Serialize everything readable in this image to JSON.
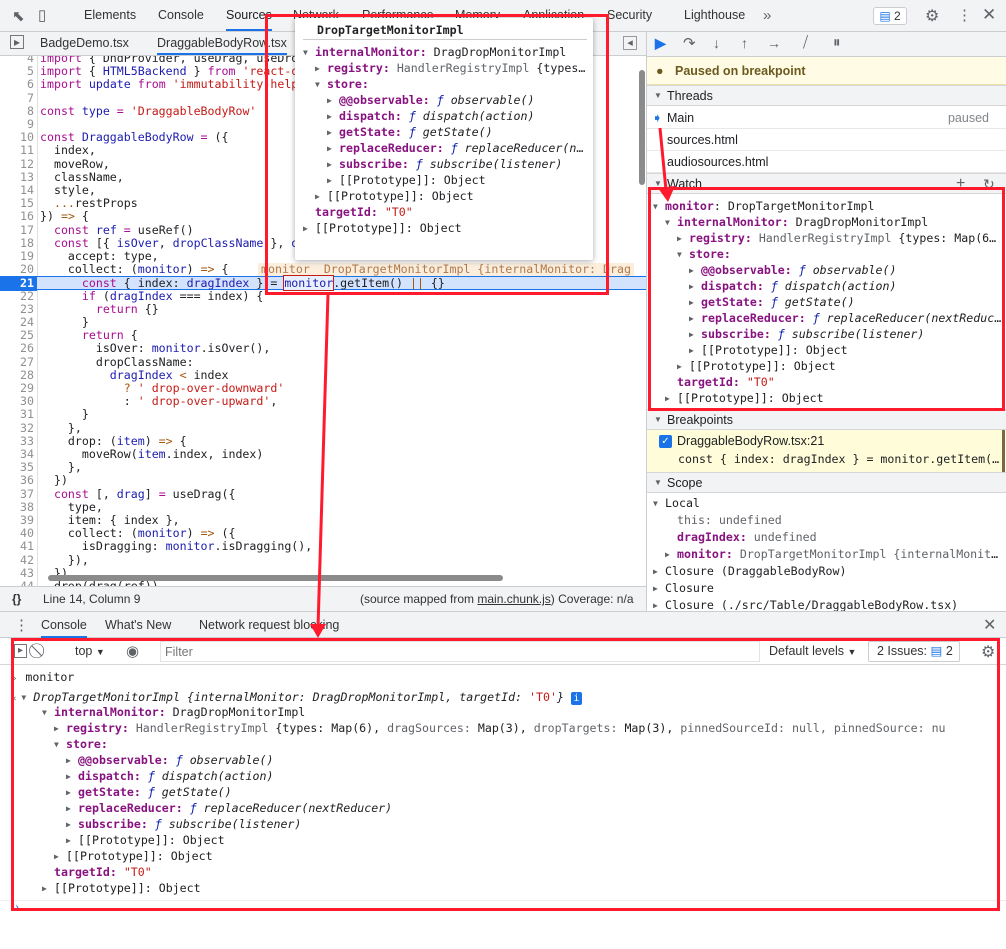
{
  "topbar": {
    "tabs": [
      "Elements",
      "Console",
      "Sources",
      "Network",
      "Performance",
      "Memory",
      "Application",
      "Security",
      "Lighthouse"
    ],
    "active_tab": "Sources",
    "more": "»",
    "issues_count": "2"
  },
  "file_tabs": {
    "items": [
      "BadgeDemo.tsx",
      "DraggableBodyRow.tsx"
    ],
    "active": "DraggableBodyRow.tsx"
  },
  "editor": {
    "current_line": 21,
    "inline_hint": "monitor  DropTargetMonitorImpl {internalMonitor: Drag",
    "lines": [
      {
        "n": "4",
        "t": [
          [
            "k",
            "import"
          ],
          [
            "p",
            " { DndProvider, useDrag, useDrop } from 'react-dnd'"
          ]
        ]
      },
      {
        "n": "5",
        "t": [
          [
            "k",
            "import"
          ],
          [
            "p",
            " { "
          ],
          [
            "d",
            "HTML5Backend"
          ],
          [
            "p",
            " } "
          ],
          [
            "k",
            "from"
          ],
          [
            "s",
            " 'react-dnd-html5-backend'"
          ]
        ]
      },
      {
        "n": "6",
        "t": [
          [
            "k",
            "import"
          ],
          [
            "p",
            " "
          ],
          [
            "d",
            "update"
          ],
          [
            "p",
            " "
          ],
          [
            "k",
            "from"
          ],
          [
            "s",
            " 'immutability-helper'"
          ]
        ]
      },
      {
        "n": "7",
        "t": []
      },
      {
        "n": "8",
        "t": [
          [
            "k",
            "const"
          ],
          [
            "p",
            " "
          ],
          [
            "d",
            "type"
          ],
          [
            "k",
            " ="
          ],
          [
            "s",
            " 'DraggableBodyRow'"
          ]
        ]
      },
      {
        "n": "9",
        "t": []
      },
      {
        "n": "10",
        "t": [
          [
            "k",
            "const"
          ],
          [
            "p",
            " "
          ],
          [
            "d",
            "DraggableBodyRow"
          ],
          [
            "k",
            " ="
          ],
          [
            "p",
            " ({"
          ]
        ]
      },
      {
        "n": "11",
        "t": [
          [
            "p",
            "  index,"
          ]
        ]
      },
      {
        "n": "12",
        "t": [
          [
            "p",
            "  moveRow,"
          ]
        ]
      },
      {
        "n": "13",
        "t": [
          [
            "p",
            "  className,"
          ]
        ]
      },
      {
        "n": "14",
        "t": [
          [
            "p",
            "  style,"
          ]
        ]
      },
      {
        "n": "15",
        "t": [
          [
            "a",
            "  ..."
          ],
          [
            "p",
            "restProps"
          ]
        ]
      },
      {
        "n": "16",
        "t": [
          [
            "p",
            "}) "
          ],
          [
            "a",
            "=>"
          ],
          [
            "p",
            " {"
          ]
        ]
      },
      {
        "n": "17",
        "t": [
          [
            "k",
            "  const"
          ],
          [
            "p",
            " "
          ],
          [
            "d",
            "ref"
          ],
          [
            "k",
            " ="
          ],
          [
            "p",
            " useRef()"
          ]
        ]
      },
      {
        "n": "18",
        "t": [
          [
            "k",
            "  const"
          ],
          [
            "p",
            " [{ "
          ],
          [
            "d",
            "isOver"
          ],
          [
            "p",
            ", "
          ],
          [
            "d",
            "dropClassName"
          ],
          [
            "p",
            " }, "
          ],
          [
            "d",
            "drop"
          ],
          [
            "p",
            "] = useDrop({"
          ]
        ]
      },
      {
        "n": "19",
        "t": [
          [
            "p",
            "    accept: type,"
          ]
        ]
      },
      {
        "n": "20",
        "t": [
          [
            "p",
            "    collect: ("
          ],
          [
            "d",
            "monitor"
          ],
          [
            "p",
            ") "
          ],
          [
            "a",
            "=>"
          ],
          [
            "p",
            " {"
          ]
        ]
      },
      {
        "n": "21",
        "t": [
          [
            "k",
            "      const"
          ],
          [
            "p",
            " { index: "
          ],
          [
            "d",
            "dragIndex"
          ],
          [
            "p",
            " } = "
          ],
          [
            "m",
            "monitor"
          ],
          [
            "p",
            ".getItem() "
          ],
          [
            "a",
            "||"
          ],
          [
            "p",
            " {}"
          ]
        ]
      },
      {
        "n": "22",
        "t": [
          [
            "k",
            "      if"
          ],
          [
            "p",
            " ("
          ],
          [
            "d",
            "dragIndex"
          ],
          [
            "p",
            " === index) {"
          ]
        ]
      },
      {
        "n": "23",
        "t": [
          [
            "k",
            "        return"
          ],
          [
            "p",
            " {}"
          ]
        ]
      },
      {
        "n": "24",
        "t": [
          [
            "p",
            "      }"
          ]
        ]
      },
      {
        "n": "25",
        "t": [
          [
            "k",
            "      return"
          ],
          [
            "p",
            " {"
          ]
        ]
      },
      {
        "n": "26",
        "t": [
          [
            "p",
            "        isOver: "
          ],
          [
            "d",
            "monitor"
          ],
          [
            "p",
            ".isOver(),"
          ]
        ]
      },
      {
        "n": "27",
        "t": [
          [
            "p",
            "        dropClassName:"
          ]
        ]
      },
      {
        "n": "28",
        "t": [
          [
            "d",
            "          dragIndex"
          ],
          [
            "a",
            " <"
          ],
          [
            "p",
            " index"
          ]
        ]
      },
      {
        "n": "29",
        "t": [
          [
            "a",
            "            ?"
          ],
          [
            "s",
            " ' drop-over-downward'"
          ]
        ]
      },
      {
        "n": "30",
        "t": [
          [
            "p",
            "            : "
          ],
          [
            "s",
            "' drop-over-upward'"
          ],
          [
            "p",
            ","
          ]
        ]
      },
      {
        "n": "31",
        "t": [
          [
            "p",
            "      }"
          ]
        ]
      },
      {
        "n": "32",
        "t": [
          [
            "p",
            "    },"
          ]
        ]
      },
      {
        "n": "33",
        "t": [
          [
            "p",
            "    drop: ("
          ],
          [
            "d",
            "item"
          ],
          [
            "p",
            ") "
          ],
          [
            "a",
            "=>"
          ],
          [
            "p",
            " {"
          ]
        ]
      },
      {
        "n": "34",
        "t": [
          [
            "p",
            "      moveRow("
          ],
          [
            "d",
            "item"
          ],
          [
            "p",
            ".index, index)"
          ]
        ]
      },
      {
        "n": "35",
        "t": [
          [
            "p",
            "    },"
          ]
        ]
      },
      {
        "n": "36",
        "t": [
          [
            "p",
            "  })"
          ]
        ]
      },
      {
        "n": "37",
        "t": [
          [
            "k",
            "  const"
          ],
          [
            "p",
            " [, "
          ],
          [
            "d",
            "drag"
          ],
          [
            "p",
            "] "
          ],
          [
            "k",
            "="
          ],
          [
            "p",
            " useDrag({"
          ]
        ]
      },
      {
        "n": "38",
        "t": [
          [
            "p",
            "    type,"
          ]
        ]
      },
      {
        "n": "39",
        "t": [
          [
            "p",
            "    item: { index },"
          ]
        ]
      },
      {
        "n": "40",
        "t": [
          [
            "p",
            "    collect: ("
          ],
          [
            "d",
            "monitor"
          ],
          [
            "p",
            ") "
          ],
          [
            "a",
            "=>"
          ],
          [
            "p",
            " ({"
          ]
        ]
      },
      {
        "n": "41",
        "t": [
          [
            "p",
            "      isDragging: "
          ],
          [
            "d",
            "monitor"
          ],
          [
            "p",
            ".isDragging(),"
          ]
        ]
      },
      {
        "n": "42",
        "t": [
          [
            "p",
            "    }),"
          ]
        ]
      },
      {
        "n": "43",
        "t": [
          [
            "p",
            "  })"
          ]
        ]
      },
      {
        "n": "44",
        "t": [
          [
            "p",
            "  drop(drag(ref))"
          ]
        ]
      }
    ]
  },
  "status_bar": {
    "format_icon": "{}",
    "position": "Line 14, Column 9",
    "source_prefix": "(source mapped from ",
    "source_link": "main.chunk.js",
    "source_suffix": ")",
    "coverage": "Coverage: n/a"
  },
  "popover": {
    "title": "DropTargetMonitorImpl"
  },
  "monitor_tree": [
    {
      "d": 0,
      "tog": "down",
      "key": "internalMonitor",
      "kc": "prop",
      "v": [
        [
          "p",
          "DragDropMonitorImpl"
        ]
      ]
    },
    {
      "d": 1,
      "tog": "right",
      "key": "registry",
      "kc": "prop",
      "v": [
        [
          "g",
          "HandlerRegistryImpl "
        ],
        [
          "p",
          "{types: Map(6), "
        ],
        [
          "g",
          "dragSources: "
        ],
        [
          "p",
          "Map(3), "
        ],
        [
          "g",
          "dropTargets: "
        ],
        [
          "p",
          "Map(3), "
        ],
        [
          "g",
          "pinnedSourceId: null, pinnedSource: nu"
        ]
      ]
    },
    {
      "d": 1,
      "tog": "down",
      "key": "store",
      "kc": "prop",
      "v": []
    },
    {
      "d": 2,
      "tog": "right",
      "key": "@@observable",
      "kc": "prop",
      "v": [
        [
          "f",
          "ƒ "
        ],
        [
          "i",
          "observable()"
        ]
      ]
    },
    {
      "d": 2,
      "tog": "right",
      "key": "dispatch",
      "kc": "prop",
      "v": [
        [
          "f",
          "ƒ "
        ],
        [
          "i",
          "dispatch(action)"
        ]
      ]
    },
    {
      "d": 2,
      "tog": "right",
      "key": "getState",
      "kc": "prop",
      "v": [
        [
          "f",
          "ƒ "
        ],
        [
          "i",
          "getState()"
        ]
      ]
    },
    {
      "d": 2,
      "tog": "right",
      "key": "replaceReducer",
      "kc": "prop",
      "v": [
        [
          "f",
          "ƒ "
        ],
        [
          "i",
          "replaceReducer(nextReducer)"
        ]
      ]
    },
    {
      "d": 2,
      "tog": "right",
      "key": "subscribe",
      "kc": "prop",
      "v": [
        [
          "f",
          "ƒ "
        ],
        [
          "i",
          "subscribe(listener)"
        ]
      ]
    },
    {
      "d": 2,
      "tog": "right",
      "key": "[[Prototype]]",
      "kc": "plain",
      "v": [
        [
          "p",
          "Object"
        ]
      ]
    },
    {
      "d": 1,
      "tog": "right",
      "key": "[[Prototype]]",
      "kc": "plain",
      "v": [
        [
          "p",
          "Object"
        ]
      ]
    },
    {
      "d": 0,
      "tog": "none",
      "key": "targetId",
      "kc": "prop",
      "v": [
        [
          "s",
          "\"T0\""
        ]
      ]
    },
    {
      "d": 0,
      "tog": "right",
      "key": "[[Prototype]]",
      "kc": "plain",
      "v": [
        [
          "p",
          "Object"
        ]
      ]
    }
  ],
  "debugger": {
    "paused_message": "Paused on breakpoint",
    "threads_label": "Threads",
    "threads": [
      {
        "name": "Main",
        "status": "paused"
      },
      {
        "name": "sources.html",
        "status": ""
      },
      {
        "name": "audiosources.html",
        "status": ""
      }
    ],
    "watch_label": "Watch",
    "watch_root": {
      "key": "monitor",
      "value": "DropTargetMonitorImpl"
    },
    "breakpoints_label": "Breakpoints",
    "breakpoint": {
      "checked": true,
      "location": "DraggableBodyRow.tsx:21",
      "code": "const { index: dragIndex } = monitor.getItem() || {}"
    },
    "scope_label": "Scope",
    "scope": [
      {
        "d": 0,
        "tog": "down",
        "key": "Local",
        "kc": "plain",
        "v": []
      },
      {
        "d": 1,
        "tog": "none",
        "key": "this",
        "kc": "dim",
        "v": [
          [
            "g",
            "undefined"
          ]
        ]
      },
      {
        "d": 1,
        "tog": "none",
        "key": "dragIndex",
        "kc": "prop",
        "v": [
          [
            "g",
            "undefined"
          ]
        ]
      },
      {
        "d": 1,
        "tog": "right",
        "key": "monitor",
        "kc": "prop",
        "v": [
          [
            "g",
            "DropTargetMonitorImpl {internalMonitor: DragDropMonitorImpl, targetId: 'T0'}"
          ]
        ]
      },
      {
        "d": 0,
        "tog": "right",
        "key": "Closure (DraggableBodyRow)",
        "kc": "plain",
        "v": []
      },
      {
        "d": 0,
        "tog": "right",
        "key": "Closure",
        "kc": "plain",
        "v": []
      },
      {
        "d": 0,
        "tog": "right",
        "key": "Closure (./src/Table/DraggableBodyRow.tsx)",
        "kc": "plain",
        "v": []
      }
    ]
  },
  "drawer": {
    "tabs": [
      "Console",
      "What's New",
      "Network request blocking"
    ],
    "active_tab": "Console"
  },
  "console_toolbar": {
    "context": "top",
    "filter_placeholder": "Filter",
    "levels": "Default levels",
    "issues_label": "2 Issues:",
    "issues_count": "2"
  },
  "console": {
    "input": "monitor",
    "result_class": "DropTargetMonitorImpl",
    "result_preview_parts": [
      [
        "i",
        " {internalMonitor: DragDropMonitorImpl, targetId: "
      ],
      [
        "s",
        "'T0'"
      ],
      [
        "i",
        "}"
      ]
    ],
    "root_key": "",
    "info_badge": "i"
  },
  "colors": {
    "accent": "#1a73e8",
    "annotation": "#ff1a2e",
    "paused_banner": "#fffbe5",
    "keyword": "#aa0d91",
    "string": "#c41a16"
  }
}
